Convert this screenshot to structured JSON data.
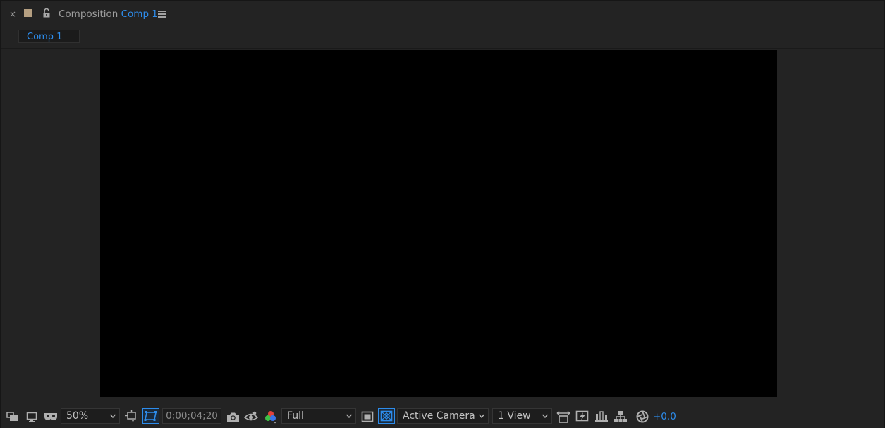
{
  "header": {
    "close_glyph": "×",
    "label_color": "#b59f81",
    "panel_name": "Composition",
    "comp_name": "Comp 1",
    "lock_icon": "lock-open-icon",
    "menu_icon": "panel-menu-icon"
  },
  "tabs": [
    {
      "label": "Comp 1",
      "active": true
    }
  ],
  "viewer": {
    "canvas_color": "#000000",
    "background_color": "#232323"
  },
  "toolbar": {
    "magnification": "50%",
    "timecode": "0;00;04;20",
    "resolution": "Full",
    "camera": "Active Camera",
    "view_layout": "1 View",
    "exposure": "+0.0",
    "accent_color": "#2d8ceb",
    "icons": [
      "always-preview-icon",
      "display-icon",
      "mask-visibility-icon",
      "region-of-interest-icon",
      "transparency-grid-icon",
      "snapshot-icon",
      "show-snapshot-icon",
      "channel-icon",
      "toggle-transparency-icon",
      "3d-draft-icon",
      "reset-exposure-icon",
      "fast-previews-icon",
      "timeline-icon",
      "flowchart-icon",
      "exposure-icon"
    ]
  }
}
